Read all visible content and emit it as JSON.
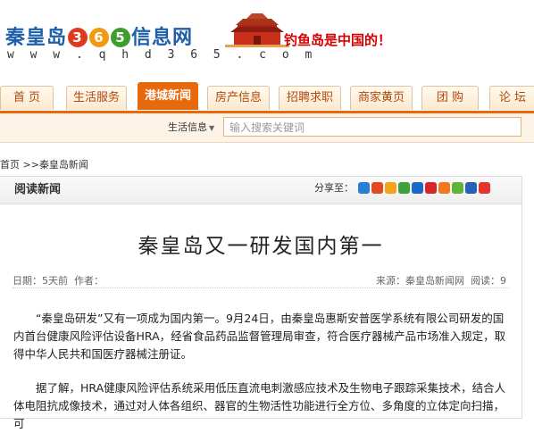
{
  "header": {
    "logo_left": "秦皇岛",
    "logo_digits": [
      "3",
      "6",
      "5"
    ],
    "logo_right": "信息网",
    "logo_url_text": "w w w . q h d 3 6 5 . c o m",
    "slogan": "钓鱼岛是中国的！"
  },
  "nav": {
    "tabs": [
      {
        "label": "首 页"
      },
      {
        "label": "生活服务"
      },
      {
        "label": "港城新闻",
        "active": true
      },
      {
        "label": "房产信息"
      },
      {
        "label": "招聘求职"
      },
      {
        "label": "商家黄页"
      },
      {
        "label": "团 购"
      },
      {
        "label": "论 坛"
      }
    ]
  },
  "search": {
    "category": "生活信息",
    "placeholder": "输入搜索关键词"
  },
  "breadcrumb": {
    "home": "首页",
    "separator": " >>",
    "current": "秦皇岛新闻"
  },
  "panel": {
    "title": "阅读新闻",
    "share_label": "分享至：",
    "share_icon_colors": [
      "#2a7fd4",
      "#e04a25",
      "#f2a21d",
      "#3fa13b",
      "#1b69c6",
      "#d6262b",
      "#f07a1b",
      "#5fb33a",
      "#2561b5",
      "#e0362e"
    ]
  },
  "article": {
    "title": "秦皇岛又一研发国内第一",
    "date_label": "日期：5天前",
    "author_label": "作者：",
    "source_label": "来源：秦皇岛新闻网",
    "reads_label": "阅读：9",
    "paragraphs": [
      "“秦皇岛研发”又有一项成为国内第一。9月24日，由秦皇岛惠斯安普医学系统有限公司研发的国内首台健康风险评估设备HRA，经省食品药品监督管理局审查，符合医疗器械产品市场准入规定，取得中华人民共和国医疗器械注册证。",
      "据了解，HRA健康风险评估系统采用低压直流电刺激感应技术及生物电子跟踪采集技术，结合人体电阻抗成像技术，通过对人体各组织、器官的生物活性功能进行全方位、多角度的立体定向扫描，可"
    ]
  }
}
